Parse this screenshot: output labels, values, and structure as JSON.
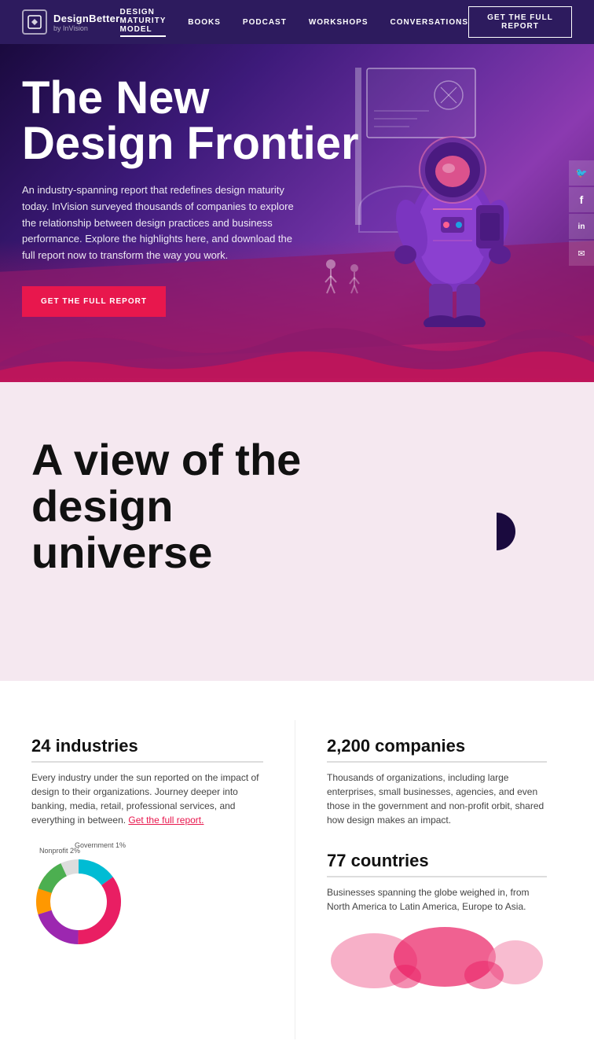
{
  "nav": {
    "logo_main": "DesignBetter",
    "logo_sub": "by InVision",
    "logo_icon": "◇",
    "links": [
      {
        "label": "DESIGN MATURITY MODEL",
        "active": true
      },
      {
        "label": "BOOKS",
        "active": false
      },
      {
        "label": "PODCAST",
        "active": false
      },
      {
        "label": "WORKSHOPS",
        "active": false
      },
      {
        "label": "CONVERSATIONS",
        "active": false
      }
    ],
    "cta": "GET THE FULL REPORT"
  },
  "hero": {
    "title_line1": "The New",
    "title_line2": "Design Frontier",
    "description": "An industry-spanning report that redefines design maturity today. InVision surveyed thousands of companies to explore the relationship between design practices and business performance. Explore the highlights here, and download the full report now to transform the way you work.",
    "cta": "GET THE FULL REPORT",
    "social_icons": [
      "🐦",
      "f",
      "in",
      "✉"
    ]
  },
  "section2": {
    "title_line1": "A view of the",
    "title_line2": "design",
    "title_line3": "universe"
  },
  "stats": {
    "stat1": {
      "title": "24 industries",
      "desc": "Every industry under the sun reported on the impact of design to their organizations. Journey deeper into banking, media, retail, professional services, and everything in between.",
      "link": "Get the full report."
    },
    "stat2": {
      "title": "2,200 companies",
      "desc": "Thousands of organizations, including large enterprises, small businesses, agencies, and even those in the government and non-profit orbit, shared how design makes an impact."
    },
    "stat3": {
      "title": "77 countries",
      "desc": "Businesses spanning the globe weighed in, from North America to Latin America, Europe to Asia."
    }
  },
  "chart": {
    "nonprofit_label": "Nonprofit 2%",
    "gov_label": "Government 1%",
    "segments": [
      {
        "color": "#00bcd4",
        "pct": 15
      },
      {
        "color": "#e91e63",
        "pct": 35
      },
      {
        "color": "#9c27b0",
        "pct": 20
      },
      {
        "color": "#ff9800",
        "pct": 15
      },
      {
        "color": "#4caf50",
        "pct": 13
      },
      {
        "color": "#f44336",
        "pct": 2
      }
    ]
  },
  "colors": {
    "accent_red": "#e8174d",
    "hero_bg_dark": "#1a0a3e",
    "hero_bg_mid": "#6b2fa0",
    "section2_bg": "#f5e8f0"
  }
}
